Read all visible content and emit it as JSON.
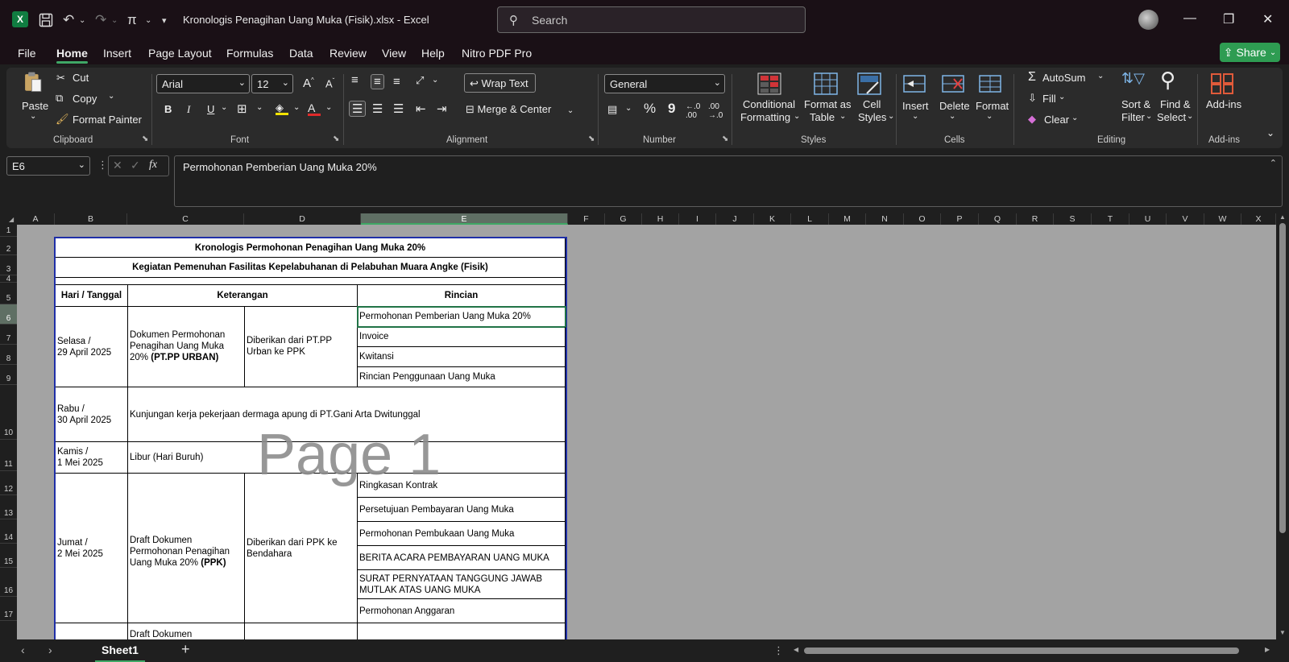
{
  "app": {
    "logo": "X",
    "document_title": "Kronologis Penagihan Uang Muka (Fisik).xlsx  -  Excel",
    "search_placeholder": "Search",
    "share_label": "Share"
  },
  "menu": [
    "File",
    "Home",
    "Insert",
    "Page Layout",
    "Formulas",
    "Data",
    "Review",
    "View",
    "Help",
    "Nitro PDF Pro"
  ],
  "ribbon": {
    "clipboard": {
      "label": "Clipboard",
      "paste": "Paste",
      "cut": "Cut",
      "copy": "Copy",
      "format_painter": "Format Painter"
    },
    "font": {
      "label": "Font",
      "family": "Arial",
      "size": "12",
      "bold": "B",
      "italic": "I",
      "underline": "U"
    },
    "alignment": {
      "label": "Alignment",
      "wrap_text": "Wrap Text",
      "merge_center": "Merge & Center"
    },
    "number": {
      "label": "Number",
      "format": "General",
      "percent": "%",
      "comma": "9"
    },
    "styles": {
      "label": "Styles",
      "conditional_1": "Conditional",
      "conditional_2": "Formatting",
      "format_table_1": "Format as",
      "format_table_2": "Table",
      "cell_styles_1": "Cell",
      "cell_styles_2": "Styles"
    },
    "cells": {
      "label": "Cells",
      "insert": "Insert",
      "delete": "Delete",
      "format": "Format"
    },
    "editing": {
      "label": "Editing",
      "autosum": "AutoSum",
      "fill": "Fill",
      "clear": "Clear",
      "sort_1": "Sort &",
      "sort_2": "Filter",
      "find_1": "Find &",
      "find_2": "Select"
    },
    "addins": {
      "label": "Add-ins",
      "button": "Add-ins"
    }
  },
  "formula_bar": {
    "name_box": "E6",
    "fx": "fx",
    "content": "Permohonan Pemberian Uang Muka 20%"
  },
  "columns": [
    "A",
    "B",
    "C",
    "D",
    "E",
    "F",
    "G",
    "H",
    "I",
    "J",
    "K",
    "L",
    "M",
    "N",
    "O",
    "P",
    "Q",
    "R",
    "S",
    "T",
    "U",
    "V",
    "W",
    "X"
  ],
  "rows": [
    "1",
    "2",
    "3",
    "4",
    "5",
    "6",
    "7",
    "8",
    "9",
    "10",
    "11",
    "12",
    "13",
    "14",
    "15",
    "16",
    "17"
  ],
  "sheet": {
    "title1": "Kronologis Permohonan Penagihan Uang Muka 20%",
    "title2": "Kegiatan Pemenuhan Fasilitas Kepelabuhanan di Pelabuhan Muara Angke (Fisik)",
    "headers": {
      "date": "Hari / Tanggal",
      "desc": "Keterangan",
      "detail": "Rincian"
    },
    "block1": {
      "date": "Selasa /\n29 April 2025",
      "doc": "Dokumen Permohonan Penagihan Uang Muka 20%",
      "doc_bold": "(PT.PP URBAN)",
      "note": "Diberikan dari PT.PP Urban ke PPK",
      "items": [
        "Permohonan Pemberian Uang Muka 20%",
        "Invoice",
        "Kwitansi",
        "Rincian Penggunaan Uang Muka"
      ]
    },
    "block2": {
      "date": "Rabu /\n30 April 2025",
      "desc": "Kunjungan kerja pekerjaan dermaga apung di PT.Gani Arta Dwitunggal"
    },
    "block3": {
      "date": "Kamis /\n1 Mei 2025",
      "desc": "Libur (Hari Buruh)"
    },
    "block4": {
      "date": "Jumat /\n2 Mei 2025",
      "doc": "Draft Dokumen Permohonan Penagihan Uang Muka 20%",
      "doc_bold": "(PPK)",
      "note": "Diberikan dari PPK ke Bendahara",
      "items": [
        "Ringkasan Kontrak",
        "Persetujuan Pembayaran Uang Muka",
        "Permohonan Pembukaan Uang Muka",
        "BERITA ACARA PEMBAYARAN UANG MUKA",
        "SURAT PERNYATAAN TANGGUNG JAWAB MUTLAK ATAS UANG MUKA",
        "Permohonan Anggaran"
      ]
    },
    "block5": {
      "doc": "Draft Dokumen"
    },
    "watermark": "Page 1"
  },
  "tabs": {
    "sheet_name": "Sheet1",
    "add": "+"
  }
}
